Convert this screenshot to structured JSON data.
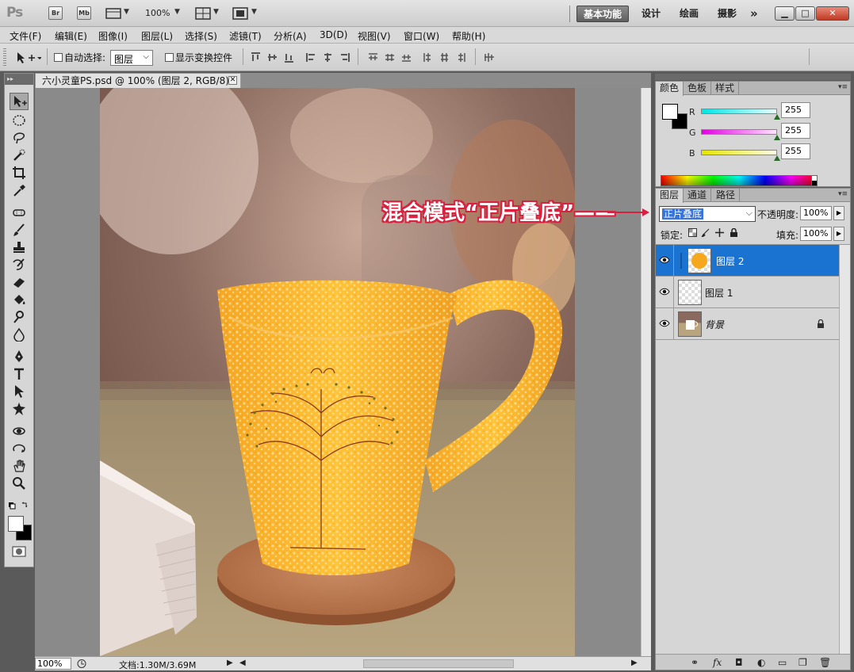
{
  "app": {
    "logo": "Ps",
    "bridge_label": "Br",
    "minibridge_label": "Mb",
    "zoom": "100%",
    "workspaces": [
      "基本功能",
      "设计",
      "绘画",
      "摄影"
    ],
    "more": "»"
  },
  "menu": [
    "文件(F)",
    "编辑(E)",
    "图像(I)",
    "图层(L)",
    "选择(S)",
    "滤镜(T)",
    "分析(A)",
    "3D(D)",
    "视图(V)",
    "窗口(W)",
    "帮助(H)"
  ],
  "options": {
    "auto_select_label": "自动选择:",
    "auto_select_value": "图层",
    "show_transform_label": "显示变换控件"
  },
  "document": {
    "tab_title": "六小灵童PS.psd @ 100% (图层 2, RGB/8) *",
    "tab_close": "✕",
    "status_zoom": "100%",
    "status_doc": "文档:1.30M/3.69M"
  },
  "annotation": {
    "text": "混合模式“正片叠底”——",
    "color": "#d8213f"
  },
  "color_panel": {
    "tabs": [
      "颜色",
      "色板",
      "样式"
    ],
    "channels": [
      {
        "label": "R",
        "value": "255",
        "color": "#00e5e5"
      },
      {
        "label": "G",
        "value": "255",
        "color": "#e000e0"
      },
      {
        "label": "B",
        "value": "255",
        "color": "#e5e500"
      }
    ]
  },
  "layers_panel": {
    "tabs": [
      "图层",
      "通道",
      "路径"
    ],
    "blend_mode": "正片叠底",
    "opacity_label": "不透明度:",
    "opacity": "100%",
    "lock_label": "锁定:",
    "fill_label": "填充:",
    "fill": "100%",
    "layers": [
      {
        "name": "图层 2",
        "selected": true
      },
      {
        "name": "图层 1",
        "selected": false
      },
      {
        "name": "背景",
        "selected": false,
        "locked": true
      }
    ],
    "accent": "#1a73d0"
  }
}
